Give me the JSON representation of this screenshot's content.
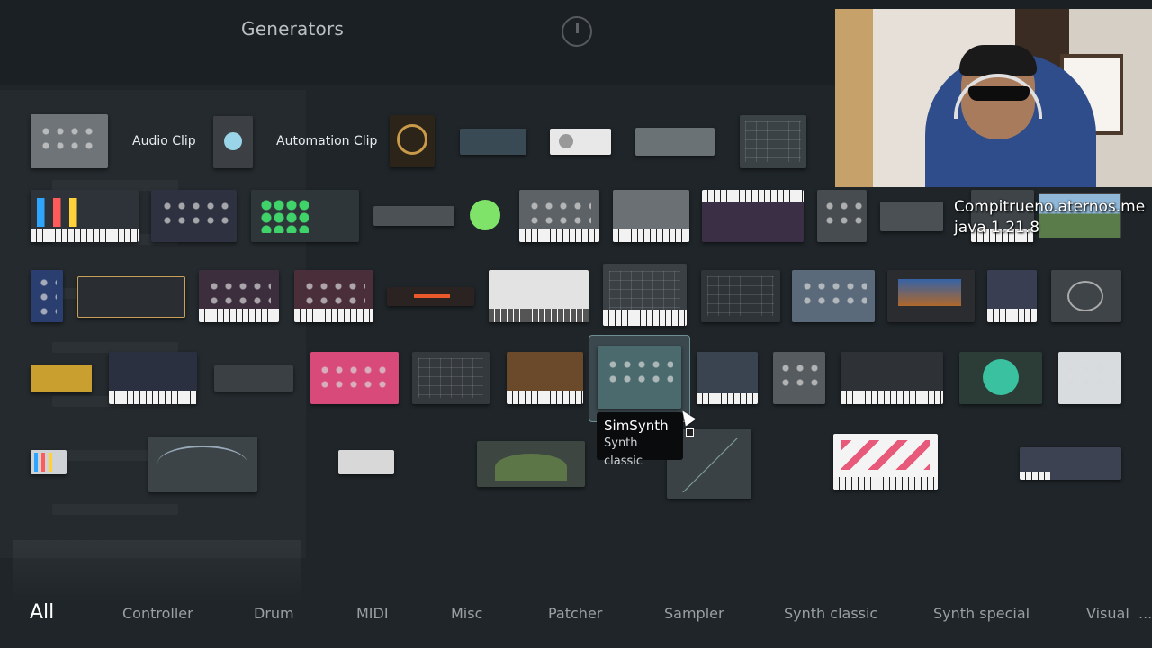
{
  "window": {
    "title": "Generators"
  },
  "tiles": {
    "audio_clip_label": "Audio Clip",
    "automation_clip_label": "Automation Clip"
  },
  "tooltip": {
    "name": "SimSynth",
    "category": "Synth classic"
  },
  "stream_overlay": {
    "server_line1": "Compitrueno.aternos.me",
    "server_line2": "java 1.21.8"
  },
  "categories": [
    {
      "label": "All",
      "active": true
    },
    {
      "label": "Controller"
    },
    {
      "label": "Drum"
    },
    {
      "label": "MIDI"
    },
    {
      "label": "Misc"
    },
    {
      "label": "Patcher"
    },
    {
      "label": "Sampler"
    },
    {
      "label": "Synth classic"
    },
    {
      "label": "Synth special"
    },
    {
      "label": "Visual"
    },
    {
      "label": "..."
    }
  ],
  "colors": {
    "background": "#1f2529",
    "selection_highlight": "#6f8d95",
    "tooltip_bg": "#0a0b0c",
    "active_category": "#ffffff",
    "inactive_category": "#98a0a4"
  }
}
